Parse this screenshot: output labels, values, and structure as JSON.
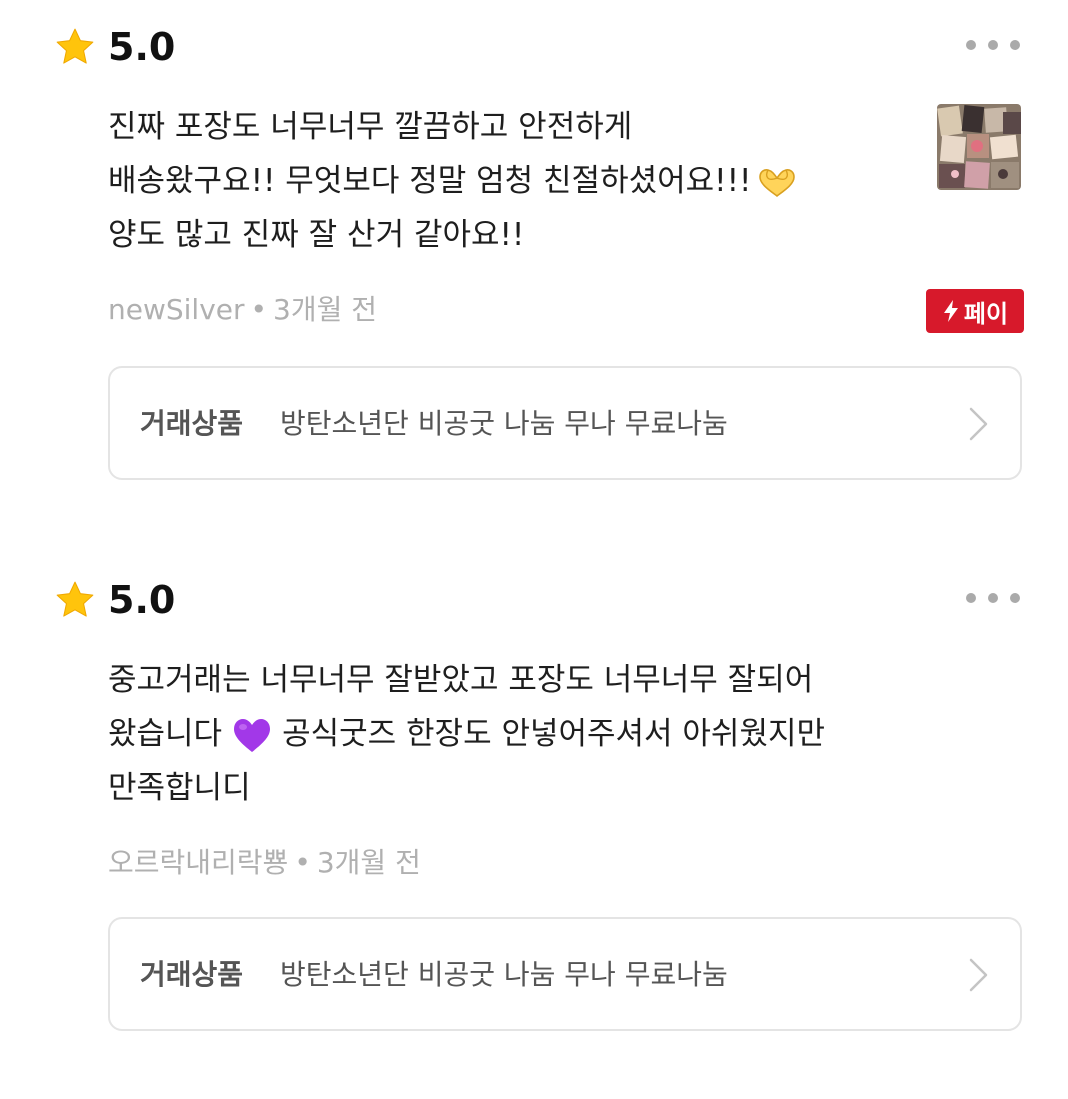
{
  "reviews": [
    {
      "score": "5.0",
      "text_lines": [
        "진짜 포장도 너무너무 깔끔하고 안전하게",
        "배송왔구요!! 무엇보다 정말 엄청 친절하셨어요!!!",
        "양도 많고 진짜 잘 산거 같아요!!"
      ],
      "emoji": "heart-hands-emoji",
      "reviewer": "newSilver",
      "time": "3개월 전",
      "pay_badge": "페이",
      "product_label": "거래상품",
      "product_name": "방탄소년단 비공굿 나눔 무나 무료나눔"
    },
    {
      "score": "5.0",
      "text_lines": [
        "중고거래는 너무너무 잘받았고 포장도 너무너무 잘되어",
        "왔습니다",
        "공식굿즈 한장도 안넣어주셔서 아쉬웠지만",
        "만족합니디"
      ],
      "emoji": "purple-heart-emoji",
      "reviewer": "오르락내리락뿅",
      "time": "3개월 전",
      "product_label": "거래상품",
      "product_name": "방탄소년단 비공굿 나눔 무나 무료나눔"
    }
  ],
  "separator": "•",
  "colors": {
    "star": "#ffc40c",
    "pay_badge": "#d7192b",
    "meta": "#b0b0b0",
    "border": "#e4e4e4"
  }
}
